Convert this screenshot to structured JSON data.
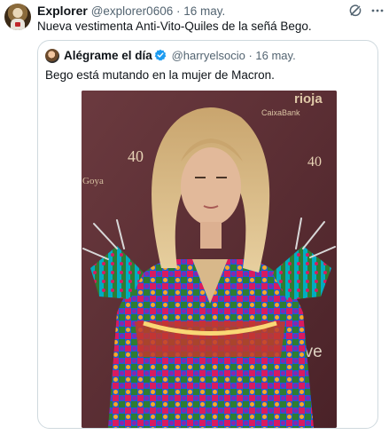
{
  "tweet": {
    "author_name": "Explorer",
    "author_handle": "@explorer0606",
    "separator": " · ",
    "date": "16 may.",
    "text": "Nueva vestimenta Anti-Vito-Quiles de la señá Bego.",
    "icons": {
      "grok": "grok-icon",
      "more": "more-icon"
    }
  },
  "quoted": {
    "author_name": "Alégrame el día",
    "verified": "verified-icon",
    "author_handle": "@harryelsocio",
    "separator": " · ",
    "date": "16 may.",
    "text": "Bego está mutando en la mujer de Macron.",
    "photo": {
      "backdrop_text": [
        "40",
        "40",
        "Goya",
        "CaixaBank",
        "rioja",
        "rtve"
      ],
      "colors": {
        "backdrop": "#5a2e33",
        "hair": "#d9b683",
        "sequins": [
          "#2e7d32",
          "#1e5bd8",
          "#d81b60",
          "#f9a825",
          "#8e24aa",
          "#00acc1"
        ]
      }
    },
    "colors": {
      "verified": "#1d9bf0",
      "border": "#cfd9de",
      "secondary_text": "#536471"
    }
  }
}
